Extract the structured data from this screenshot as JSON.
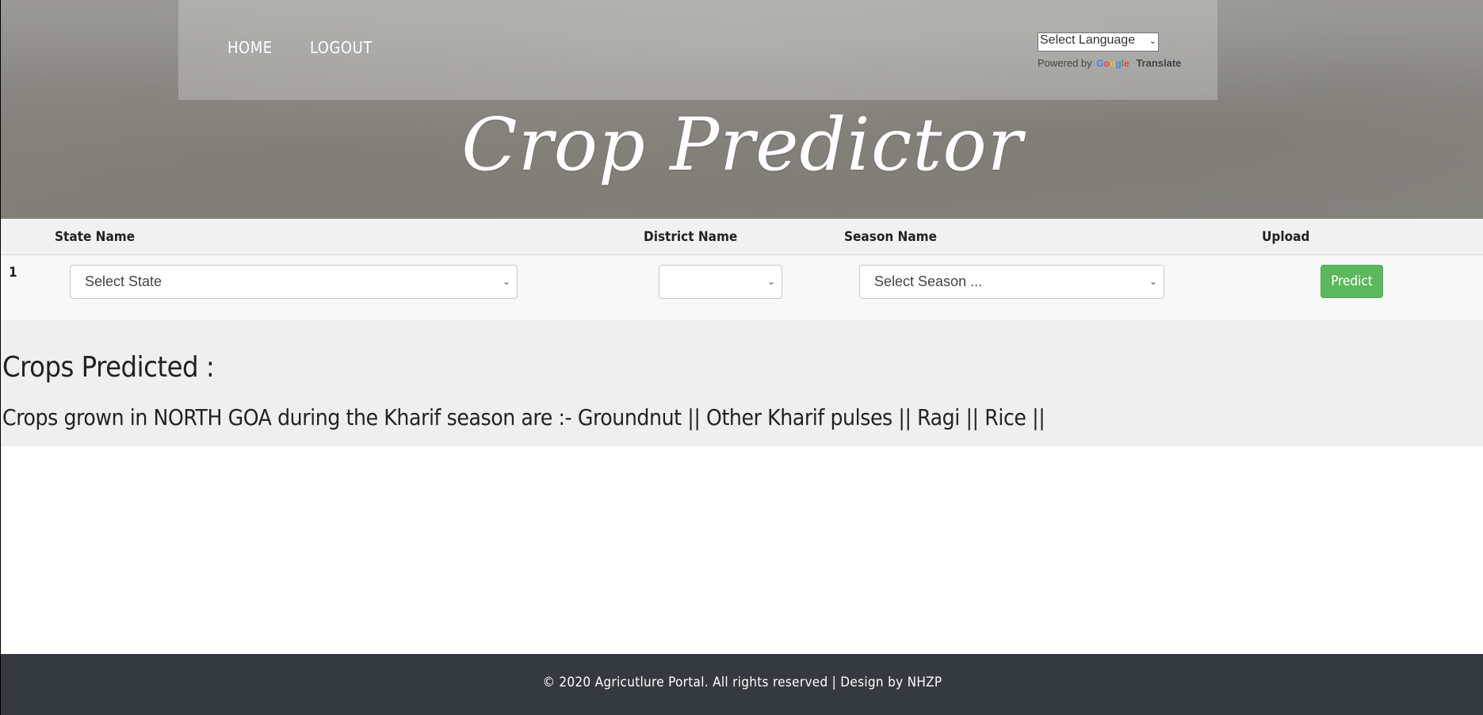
{
  "nav": {
    "home": "HOME",
    "logout": "LOGOUT"
  },
  "translate": {
    "select_label": "Select Language",
    "powered_by": "Powered by",
    "google_logo": "Google",
    "translate_label": "Translate"
  },
  "hero": {
    "title": "Crop Predictor"
  },
  "form": {
    "headers": {
      "state": "State Name",
      "district": "District Name",
      "season": "Season Name",
      "upload": "Upload"
    },
    "row_number": "1",
    "state_select": "Select State",
    "district_select": "",
    "season_select": "Select Season ...",
    "predict_button": "Predict"
  },
  "results": {
    "heading": "Crops Predicted :",
    "message": "Crops grown in NORTH GOA during the Kharif season are :- Groundnut || Other Kharif pulses || Ragi || Rice ||"
  },
  "footer": {
    "text": "© 2020 Agricutlure Portal. All rights reserved | Design by NHZP"
  },
  "colors": {
    "predict_button": "#5cb85c",
    "footer_bg": "#343a40",
    "results_bg": "#efefef"
  }
}
